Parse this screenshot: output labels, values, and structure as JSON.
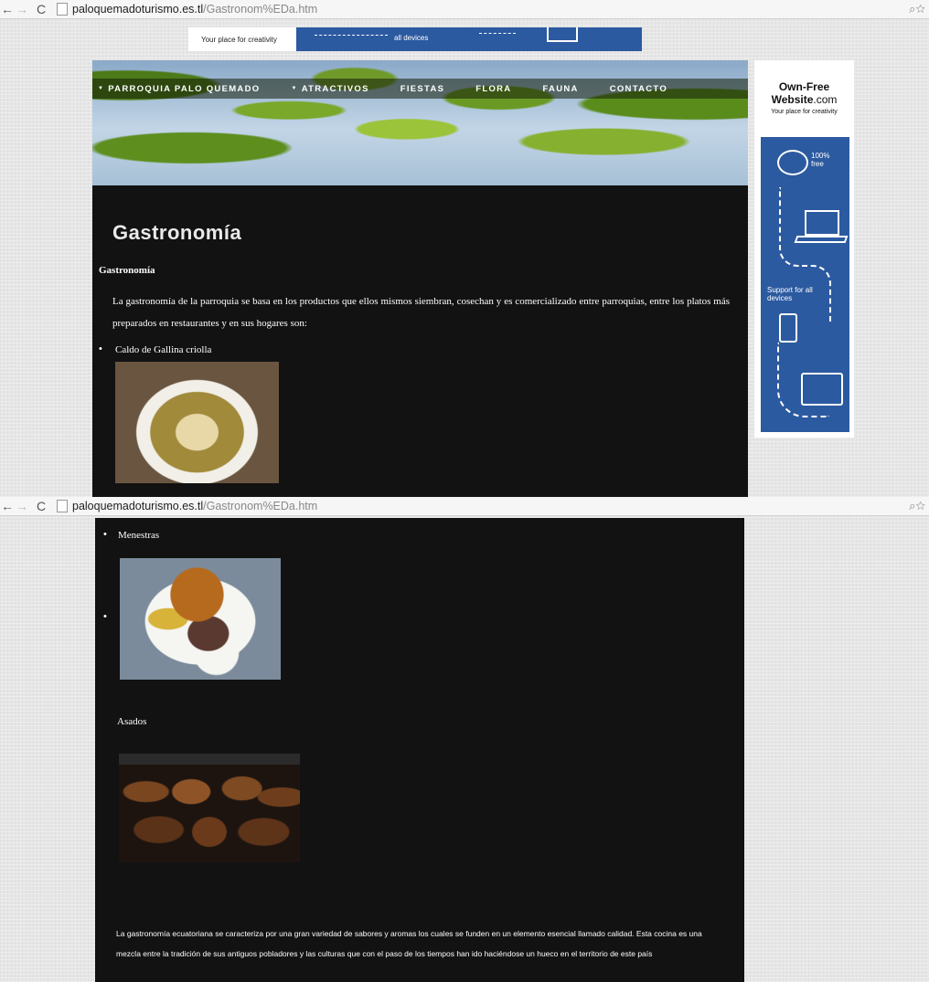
{
  "browser": {
    "url_domain": "paloquemadoturismo.es.tl",
    "url_path": "/Gastronom%EDa.htm"
  },
  "top_banner": {
    "left_text": "Your place for creativity",
    "blue_text": "all devices"
  },
  "nav": {
    "items": [
      {
        "label": "PARROQUIA PALO QUEMADO",
        "has_arrow": true
      },
      {
        "label": "ATRACTIVOS",
        "has_arrow": true
      },
      {
        "label": "FIESTAS",
        "has_arrow": false
      },
      {
        "label": "FLORA",
        "has_arrow": false
      },
      {
        "label": "FAUNA",
        "has_arrow": false
      },
      {
        "label": "CONTACTO",
        "has_arrow": false
      }
    ],
    "arrow_glyph": "▼"
  },
  "content": {
    "title": "Gastronomía",
    "subtitle": "Gastronomía",
    "intro": "La gastronomía de la parroquia se basa en los productos que ellos mismos siembran, cosechan y es comercializado entre parroquias, entre los platos más preparados en restaurantes y en sus hogares son:",
    "dishes": [
      {
        "name": "Caldo de Gallina criolla"
      },
      {
        "name": "Menestras"
      },
      {
        "name": "Asados"
      }
    ],
    "closing": "La gastronomía ecuatoriana se caracteriza por una gran variedad de sabores y aromas los cuales se funden en un elemento esencial llamado calidad. Esta cocina es una mezcla entre la tradición de sus antiguos pobladores y las culturas que con el paso de los tiempos han ido haciéndose un hueco en el territorio de este país"
  },
  "side_ad": {
    "brand_line1": "Own-Free",
    "brand_bold": "Website",
    "brand_suffix": ".com",
    "tagline": "Your place for creativity",
    "free_text": "100% free",
    "support_text": "Support for all devices",
    "panel_color": "#2c5aa0"
  },
  "colors": {
    "content_bg": "#121212",
    "page_bg": "#e6e6e6"
  }
}
